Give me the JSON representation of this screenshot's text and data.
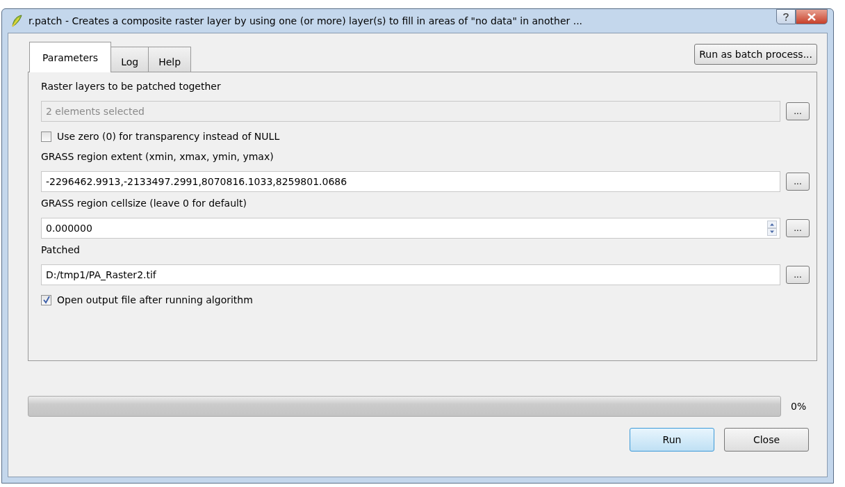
{
  "window": {
    "title": "r.patch - Creates a composite raster layer by using one (or more) layer(s) to fill in areas of \"no data\" in another ..."
  },
  "tabs": [
    {
      "label": "Parameters",
      "selected": true
    },
    {
      "label": "Log",
      "selected": false
    },
    {
      "label": "Help",
      "selected": false
    }
  ],
  "batch_button": "Run as batch process...",
  "parameters": [
    {
      "kind": "field",
      "label": "Raster layers to be patched together",
      "value": "2 elements selected",
      "disabled": true,
      "spinner": false,
      "browse": "..."
    },
    {
      "kind": "checkbox",
      "label": "Use zero (0) for transparency instead of NULL",
      "checked": false
    },
    {
      "kind": "field",
      "label": "GRASS region extent (xmin, xmax, ymin, ymax)",
      "value": "-2296462.9913,-2133497.2991,8070816.1033,8259801.0686",
      "disabled": false,
      "spinner": false,
      "browse": "..."
    },
    {
      "kind": "field",
      "label": "GRASS region cellsize (leave 0 for default)",
      "value": "0.000000",
      "disabled": false,
      "spinner": true,
      "browse": "..."
    },
    {
      "kind": "field",
      "label": "Patched",
      "value": "D:/tmp1/PA_Raster2.tif",
      "disabled": false,
      "spinner": false,
      "browse": "..."
    },
    {
      "kind": "checkbox",
      "label": "Open output file after running algorithm",
      "checked": true
    }
  ],
  "progress": {
    "level": 0,
    "reading": "0%"
  },
  "buttons": [
    {
      "label": "Run",
      "default": true
    },
    {
      "label": "Close",
      "default": false
    }
  ]
}
